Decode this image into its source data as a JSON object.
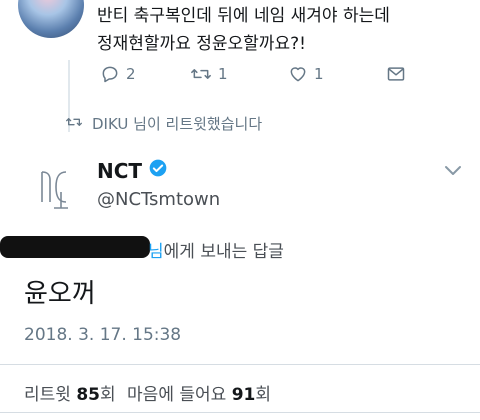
{
  "tweet": {
    "text_line1": "반티 축구복인데 뒤에 네임 새겨야 하는데",
    "text_line2": "정재현할까요 정윤오할까요?!",
    "actions": {
      "reply_count": "2",
      "retweet_count": "1",
      "like_count": "1"
    }
  },
  "retweet_notice": "DIKU 님이 리트윗했습니다",
  "account": {
    "name": "NCT",
    "handle": "@NCTsmtown"
  },
  "reply_to": {
    "mention_suffix": "님",
    "text": "에게 보내는 답글"
  },
  "reply": {
    "text": "윤오꺼",
    "timestamp": "2018. 3. 17. 15:38"
  },
  "stats": {
    "retweet_label": "리트윗",
    "retweet_count": "85",
    "retweet_unit": "회",
    "like_label": "마음에 들어요",
    "like_count": "91",
    "like_unit": "회"
  },
  "colors": {
    "accent": "#1da1f2",
    "muted": "#657786",
    "verified": "#1da1f2"
  }
}
